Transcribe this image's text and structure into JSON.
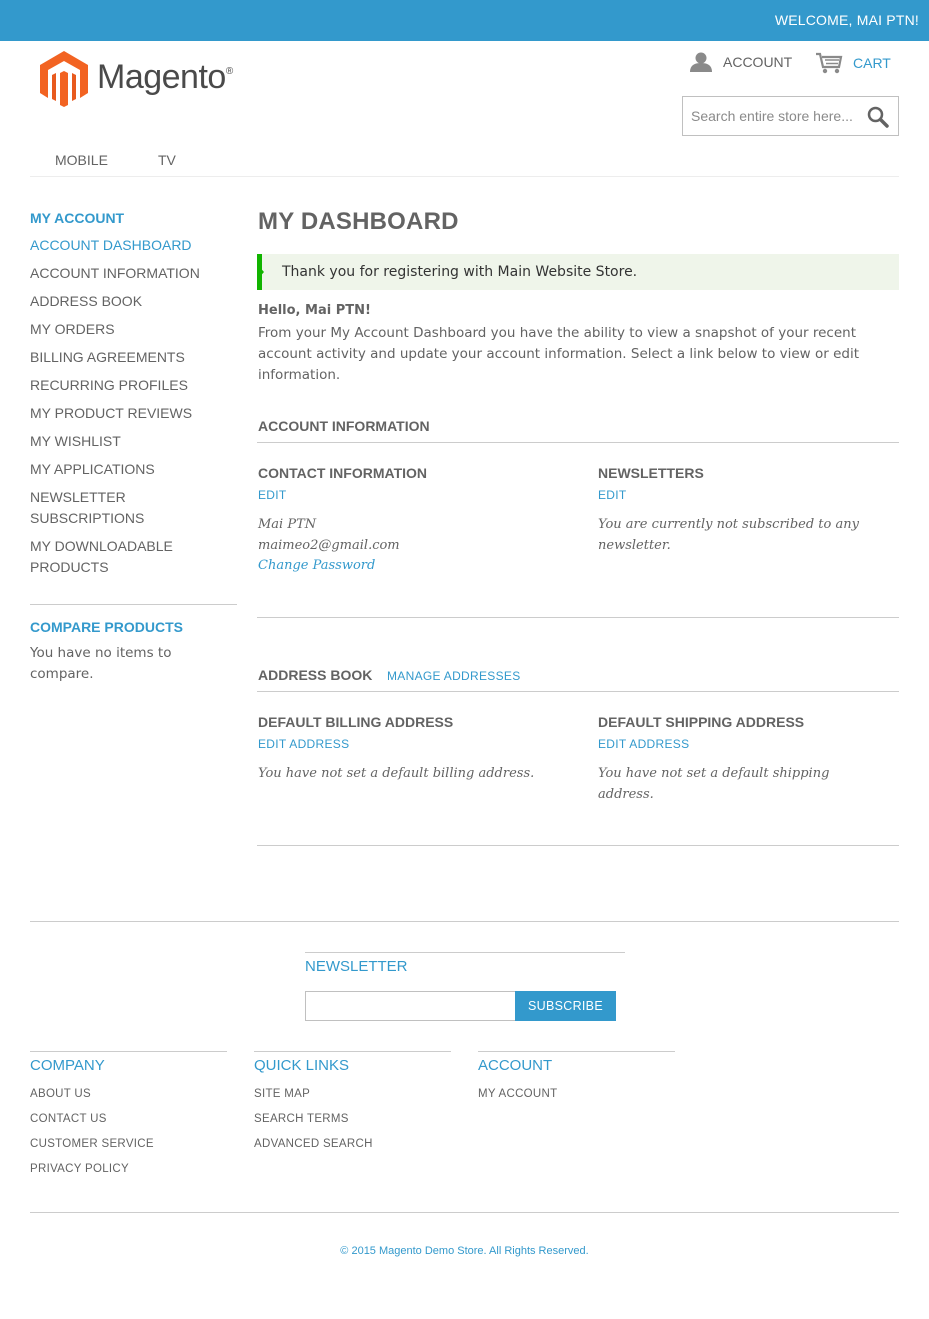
{
  "header": {
    "welcome": "WELCOME, MAI PTN!",
    "logo_text": "Magento",
    "logo_mark": "®",
    "account_label": "ACCOUNT",
    "cart_label": "CART",
    "search_placeholder": "Search entire store here..."
  },
  "nav": {
    "items": [
      {
        "label": "MOBILE"
      },
      {
        "label": "TV"
      }
    ]
  },
  "sidebar": {
    "title": "MY ACCOUNT",
    "items": [
      {
        "label": "ACCOUNT DASHBOARD",
        "active": true
      },
      {
        "label": "ACCOUNT INFORMATION"
      },
      {
        "label": "ADDRESS BOOK"
      },
      {
        "label": "MY ORDERS"
      },
      {
        "label": "BILLING AGREEMENTS"
      },
      {
        "label": "RECURRING PROFILES"
      },
      {
        "label": "MY PRODUCT REVIEWS"
      },
      {
        "label": "MY WISHLIST"
      },
      {
        "label": "MY APPLICATIONS"
      },
      {
        "label": "NEWSLETTER SUBSCRIPTIONS"
      },
      {
        "label": "MY DOWNLOADABLE PRODUCTS"
      }
    ],
    "compare_title": "COMPARE PRODUCTS",
    "compare_text": "You have no items to compare."
  },
  "main": {
    "title": "MY DASHBOARD",
    "success_message": "Thank you for registering with Main Website Store.",
    "hello": "Hello, Mai PTN!",
    "intro": "From your My Account Dashboard you have the ability to view a snapshot of your recent account activity and update your account information. Select a link below to view or edit information.",
    "account_info_title": "ACCOUNT INFORMATION",
    "contact_title": "CONTACT INFORMATION",
    "contact_edit": "EDIT",
    "contact_name": "Mai PTN",
    "contact_email": "maimeo2@gmail.com",
    "change_password": "Change Password",
    "newsletters_title": "NEWSLETTERS",
    "newsletters_edit": "EDIT",
    "newsletters_text": "You are currently not subscribed to any newsletter.",
    "address_book_title": "ADDRESS BOOK",
    "manage_addresses": "MANAGE ADDRESSES",
    "billing_title": "DEFAULT BILLING ADDRESS",
    "billing_edit": "EDIT ADDRESS",
    "billing_text": "You have not set a default billing address.",
    "shipping_title": "DEFAULT SHIPPING ADDRESS",
    "shipping_edit": "EDIT ADDRESS",
    "shipping_text": "You have not set a default shipping address."
  },
  "footer": {
    "newsletter_title": "NEWSLETTER",
    "subscribe_label": "SUBSCRIBE",
    "company_title": "COMPANY",
    "company_links": [
      "ABOUT US",
      "CONTACT US",
      "CUSTOMER SERVICE",
      "PRIVACY POLICY"
    ],
    "quick_title": "QUICK LINKS",
    "quick_links": [
      "SITE MAP",
      "SEARCH TERMS",
      "ADVANCED SEARCH"
    ],
    "account_title": "ACCOUNT",
    "account_links": [
      "MY ACCOUNT"
    ],
    "copyright": "© 2015 Magento Demo Store. All Rights Reserved."
  },
  "colors": {
    "accent": "#3399cc",
    "text": "#636363",
    "success_border": "#11b400",
    "success_bg": "#eff5ea",
    "logo_orange": "#f26322"
  },
  "icons": [
    "user-icon",
    "cart-icon",
    "search-icon",
    "magento-logo-icon"
  ]
}
